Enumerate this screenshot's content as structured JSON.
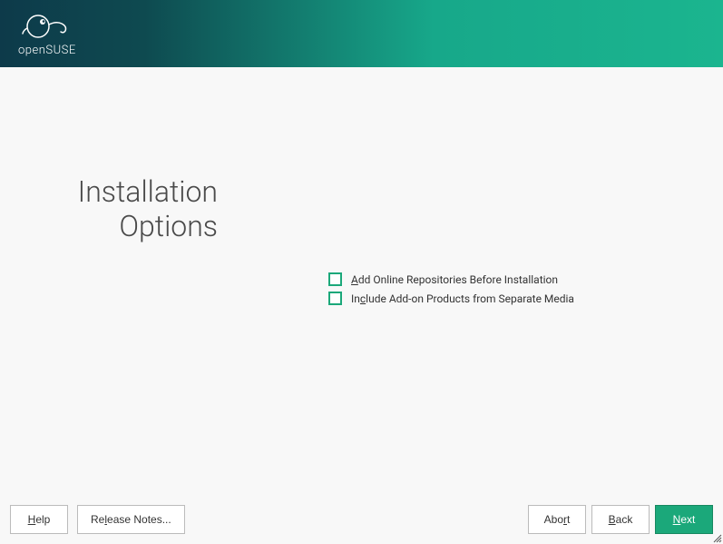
{
  "header": {
    "logo_text": "openSUSE"
  },
  "page": {
    "title_line1": "Installation",
    "title_line2": "Options"
  },
  "options": {
    "online_repos": {
      "accel": "A",
      "rest": "dd Online Repositories Before Installation",
      "checked": false
    },
    "addon_products": {
      "pre": "In",
      "accel": "c",
      "rest": "lude Add-on Products from Separate Media",
      "checked": false
    }
  },
  "footer": {
    "help": {
      "accel": "H",
      "rest": "elp"
    },
    "release_notes": {
      "pre": "Re",
      "accel": "l",
      "rest": "ease Notes..."
    },
    "abort": {
      "pre": "Abo",
      "accel": "r",
      "rest": "t"
    },
    "back": {
      "accel": "B",
      "rest": "ack"
    },
    "next": {
      "accel": "N",
      "rest": "ext"
    }
  }
}
